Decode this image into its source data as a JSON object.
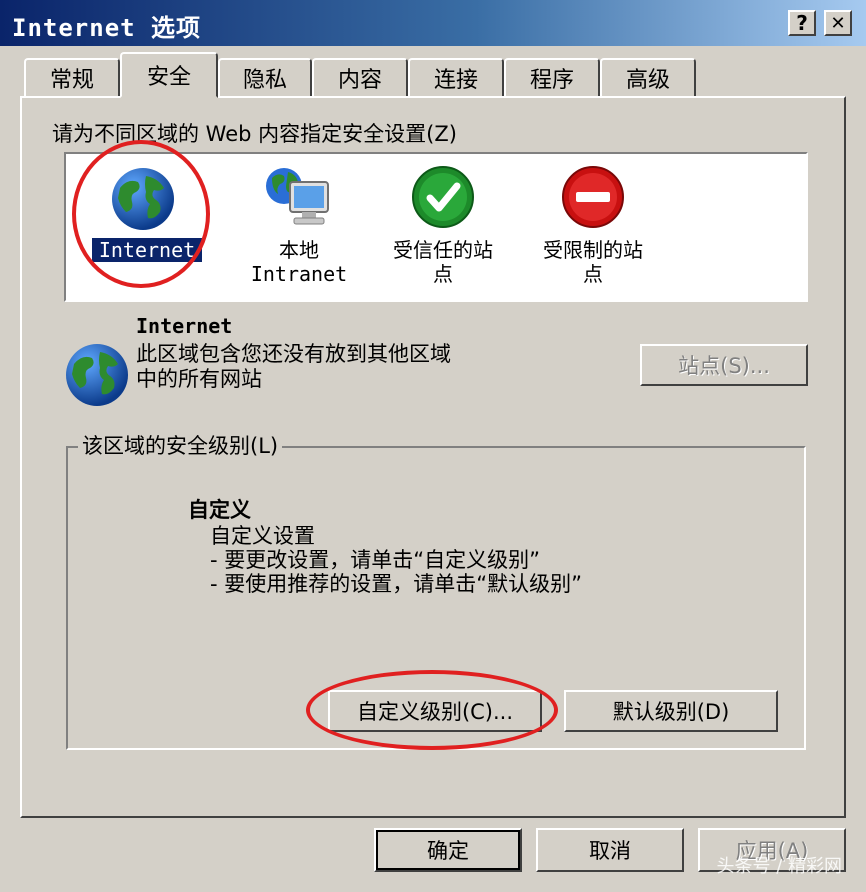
{
  "window": {
    "title": "Internet 选项",
    "help_button": "?",
    "close_button": "✕"
  },
  "tabs": [
    {
      "label": "常规",
      "active": false
    },
    {
      "label": "安全",
      "active": true
    },
    {
      "label": "隐私",
      "active": false
    },
    {
      "label": "内容",
      "active": false
    },
    {
      "label": "连接",
      "active": false
    },
    {
      "label": "程序",
      "active": false
    },
    {
      "label": "高级",
      "active": false
    }
  ],
  "security": {
    "zones_prompt": "请为不同区域的 Web 内容指定安全设置(Z)",
    "zones": [
      {
        "label_line1": "Internet",
        "label_line2": "",
        "icon": "globe-icon",
        "selected": true
      },
      {
        "label_line1": "本地",
        "label_line2": "Intranet",
        "icon": "local-intranet-icon",
        "selected": false
      },
      {
        "label_line1": "受信任的站",
        "label_line2": "点",
        "icon": "trusted-check-icon",
        "selected": false
      },
      {
        "label_line1": "受限制的站",
        "label_line2": "点",
        "icon": "restricted-icon",
        "selected": false
      }
    ],
    "zone_info": {
      "name": "Internet",
      "desc_line1": "此区域包含您还没有放到其他区域",
      "desc_line2": "中的所有网站"
    },
    "sites_button": "站点(S)...",
    "level_group_title": "该区域的安全级别(L)",
    "level": {
      "title": "自定义",
      "line1": "自定义设置",
      "line2": "- 要更改设置，请单击“自定义级别”",
      "line3": "- 要使用推荐的设置，请单击“默认级别”"
    },
    "custom_level_button": "自定义级别(C)...",
    "default_level_button": "默认级别(D)"
  },
  "footer": {
    "ok": "确定",
    "cancel": "取消",
    "apply": "应用(A)"
  },
  "watermark": "头条号 / 精彩网",
  "colors": {
    "title_bar": "#0a246a",
    "face": "#d4d0c8",
    "highlight": "#e02020",
    "selection": "#0a246a"
  }
}
